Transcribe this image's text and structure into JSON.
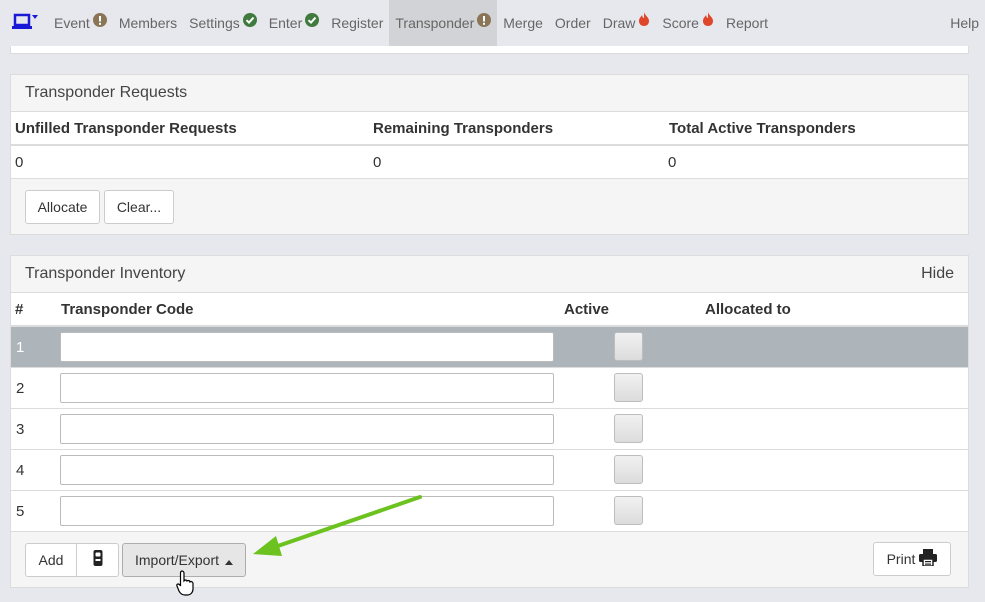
{
  "nav": {
    "items": [
      {
        "label": "Event",
        "badge": "warn"
      },
      {
        "label": "Members",
        "badge": ""
      },
      {
        "label": "Settings",
        "badge": "ok"
      },
      {
        "label": "Enter",
        "badge": "ok"
      },
      {
        "label": "Register",
        "badge": ""
      },
      {
        "label": "Transponder",
        "badge": "warn",
        "active": true
      },
      {
        "label": "Merge",
        "badge": ""
      },
      {
        "label": "Order",
        "badge": ""
      },
      {
        "label": "Draw",
        "badge": "fire"
      },
      {
        "label": "Score",
        "badge": "fire"
      },
      {
        "label": "Report",
        "badge": ""
      }
    ],
    "help": "Help"
  },
  "requests": {
    "title": "Transponder Requests",
    "headers": [
      "Unfilled Transponder Requests",
      "Remaining Transponders",
      "Total Active Transponders"
    ],
    "values": [
      "0",
      "0",
      "0"
    ],
    "allocate_label": "Allocate",
    "clear_label": "Clear..."
  },
  "inventory": {
    "title": "Transponder Inventory",
    "hide_label": "Hide",
    "headers": {
      "num": "#",
      "code": "Transponder Code",
      "active": "Active",
      "allocated": "Allocated to"
    },
    "rows": [
      {
        "num": "1",
        "code": "",
        "allocated": "",
        "selected": true
      },
      {
        "num": "2",
        "code": "",
        "allocated": ""
      },
      {
        "num": "3",
        "code": "",
        "allocated": ""
      },
      {
        "num": "4",
        "code": "",
        "allocated": ""
      },
      {
        "num": "5",
        "code": "",
        "allocated": ""
      }
    ],
    "add_label": "Add",
    "import_export_label": "Import/Export",
    "print_label": "Print"
  },
  "colors": {
    "accent": "#1a1ad6",
    "selected_row": "#adb5ba",
    "warn_badge": "#8a7556",
    "ok_badge": "#3f7a3f",
    "fire": "#e0462b",
    "arrow": "#6cc21f"
  },
  "icons": [
    "laptop-icon",
    "exclamation-icon",
    "check-icon",
    "fire-icon",
    "transponder-icon",
    "caret-up-icon",
    "printer-icon",
    "hand-cursor-icon",
    "arrow-annotation"
  ]
}
